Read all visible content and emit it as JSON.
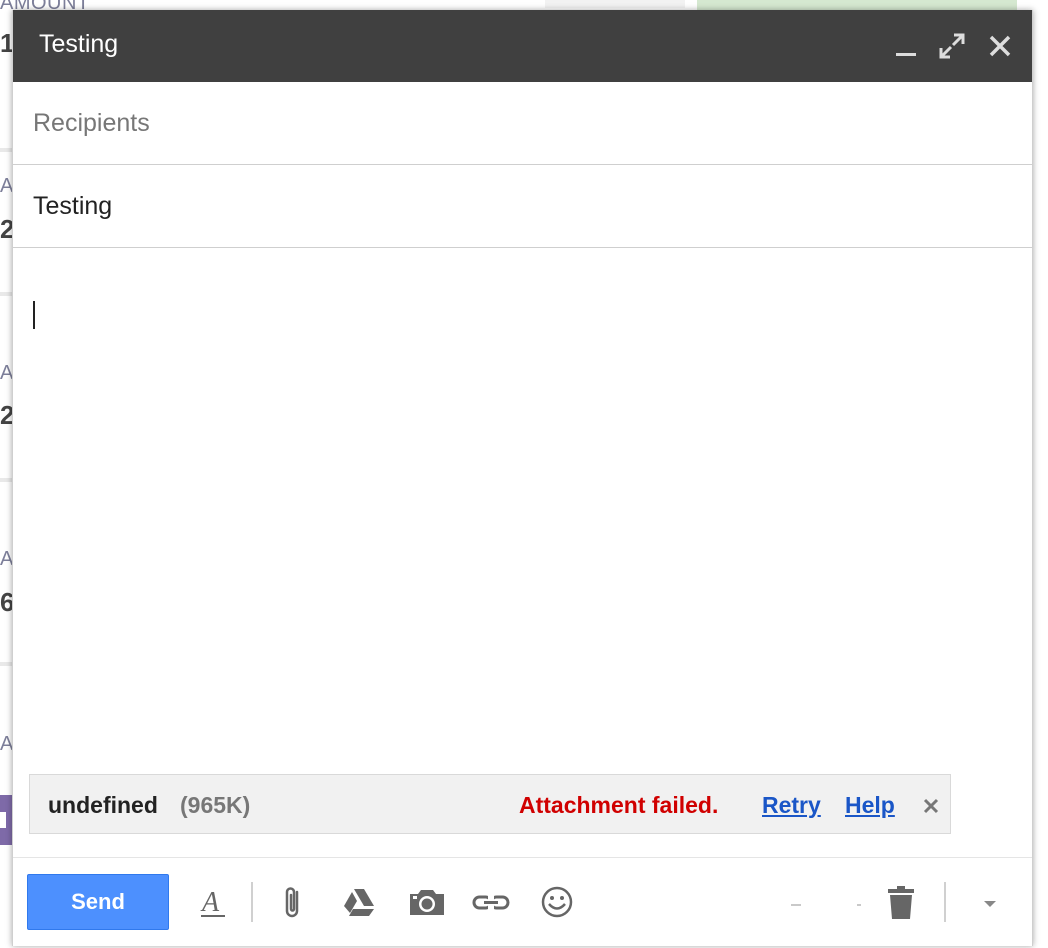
{
  "background": {
    "top_label": "AMOUNT",
    "row_letters": [
      "1",
      "A",
      "2",
      "A",
      "2",
      "A",
      "6",
      "A"
    ]
  },
  "compose": {
    "title": "Testing",
    "window_controls": [
      "minimize-icon",
      "expand-icon",
      "close-icon"
    ],
    "recipients_placeholder": "Recipients",
    "recipients_value": "",
    "subject_value": "Testing",
    "body_value": ""
  },
  "attachment": {
    "name": "undefined",
    "size": "(965K)",
    "status": "Attachment failed.",
    "retry_label": "Retry",
    "help_label": "Help"
  },
  "toolbar": {
    "send_label": "Send",
    "icons": [
      "formatting-icon",
      "paperclip-icon",
      "drive-icon",
      "camera-icon",
      "link-icon",
      "emoji-icon",
      "trash-icon",
      "chevron-down-icon"
    ]
  },
  "colors": {
    "titlebar": "#404040",
    "send_button": "#4d90fe",
    "error_text": "#d00000",
    "link_text": "#1a56c7"
  }
}
